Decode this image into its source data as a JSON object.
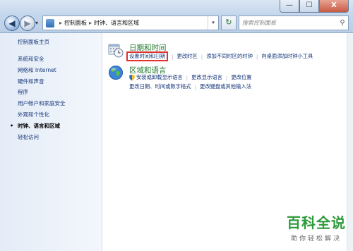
{
  "window": {
    "buttons": {
      "minimize": "—",
      "maximize": "☐",
      "close": "X"
    }
  },
  "nav": {
    "back_icon": "◀",
    "forward_icon": "▶",
    "dropdown_icon": "▾"
  },
  "address": {
    "crumbs": [
      "控制面板",
      "时钟、语言和区域"
    ],
    "separator": "▸",
    "dropdown_icon": "▾",
    "refresh_icon": "↻"
  },
  "search": {
    "placeholder": "搜索控制面板",
    "icon": "⚲"
  },
  "sidebar": {
    "home": "控制面板主页",
    "items": [
      "系统和安全",
      "网络和 Internet",
      "硬件和声音",
      "程序",
      "用户帐户和家庭安全",
      "外观和个性化",
      "时钟、语言和区域",
      "轻松访问"
    ],
    "current_index": 6,
    "bullet": "•"
  },
  "main": {
    "datetime": {
      "title": "日期和时间",
      "links": [
        "设置时间和日期",
        "更改时区",
        "添加不同时区的时钟",
        "向桌面添加时钟小工具"
      ]
    },
    "region": {
      "title": "区域和语言",
      "links_row1": [
        "安装或卸载显示语言",
        "更改显示语言",
        "更改位置"
      ],
      "links_row2": [
        "更改日期、时间或数字格式",
        "更改键盘或其他输入法"
      ]
    }
  },
  "watermark": {
    "title": "百科全说",
    "subtitle": "助你轻松解决"
  },
  "colors": {
    "link": "#15367a",
    "category_title": "#1e7a2e",
    "highlight_box": "#e03030"
  }
}
